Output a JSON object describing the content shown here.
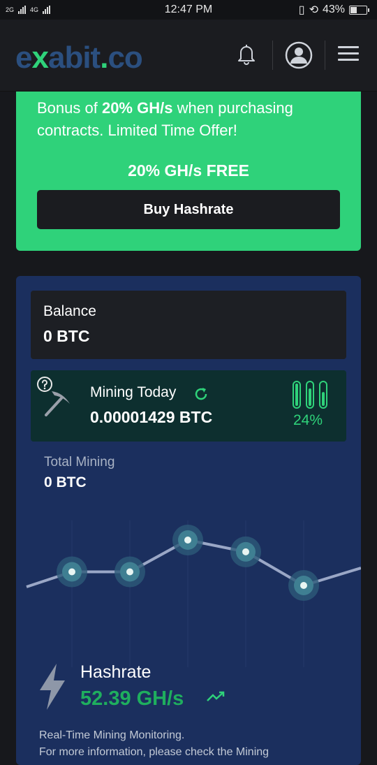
{
  "status_bar": {
    "network_1": "2G",
    "network_2": "4G",
    "time": "12:47 PM",
    "battery": "43%",
    "battery_level": 0.43
  },
  "header": {
    "logo_part1": "e",
    "logo_x": "x",
    "logo_part2": "abit",
    "logo_dot": ".",
    "logo_part3": "co",
    "icons": [
      "bell-icon",
      "user-avatar-icon",
      "hamburger-menu-icon"
    ]
  },
  "promo": {
    "line_prefix": "Bonus of ",
    "line_bold": "20% GH/s",
    "line_suffix": " when purchasing contracts. Limited Time Offer!",
    "free_label": "20% GH/s FREE",
    "button_label": "Buy Hashrate"
  },
  "balance": {
    "label": "Balance",
    "value": "0 BTC"
  },
  "mining_today": {
    "label": "Mining Today",
    "value": "0.00001429 BTC",
    "percent": "24%",
    "gauge_levels": [
      1.0,
      0.78,
      0.62
    ]
  },
  "total_mining": {
    "label": "Total Mining",
    "value": "0 BTC"
  },
  "chart_data": {
    "type": "line",
    "points": [
      105,
      105,
      140,
      127,
      90,
      128
    ],
    "color": "#9aa7c6"
  },
  "hashrate": {
    "label": "Hashrate",
    "value": "52.39 GH/s",
    "info_line1": "Real-Time Mining Monitoring.",
    "info_line2": "For more information, please check the Mining"
  },
  "colors": {
    "accent": "#2fd27a",
    "panel": "#1b2f5e",
    "dark": "#1b1c20"
  }
}
